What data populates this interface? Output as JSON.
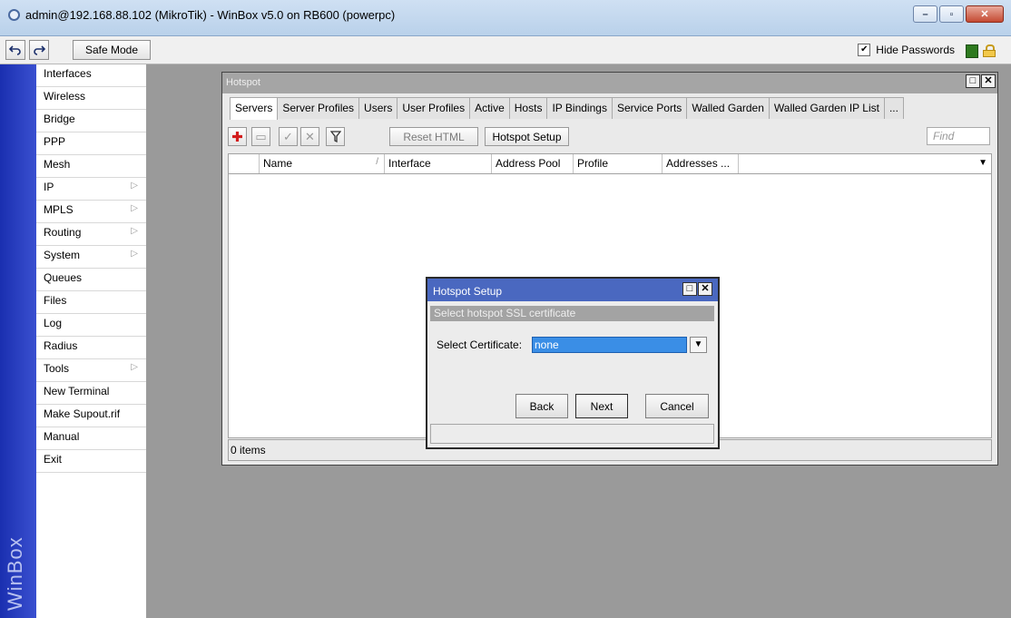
{
  "window": {
    "title": "admin@192.168.88.102 (MikroTik) - WinBox v5.0 on RB600 (powerpc)",
    "buttons": [
      "–",
      "▫",
      "✕"
    ]
  },
  "toolbar": {
    "undo_icon": "undo-icon",
    "redo_icon": "redo-icon",
    "safe_mode": "Safe Mode",
    "hide_passwords": "Hide Passwords",
    "hide_passwords_checked": true
  },
  "sidebar": {
    "brand": "WinBox",
    "items": [
      {
        "label": "Interfaces",
        "submenu": false
      },
      {
        "label": "Wireless",
        "submenu": false
      },
      {
        "label": "Bridge",
        "submenu": false
      },
      {
        "label": "PPP",
        "submenu": false
      },
      {
        "label": "Mesh",
        "submenu": false
      },
      {
        "label": "IP",
        "submenu": true
      },
      {
        "label": "MPLS",
        "submenu": true
      },
      {
        "label": "Routing",
        "submenu": true
      },
      {
        "label": "System",
        "submenu": true
      },
      {
        "label": "Queues",
        "submenu": false
      },
      {
        "label": "Files",
        "submenu": false
      },
      {
        "label": "Log",
        "submenu": false
      },
      {
        "label": "Radius",
        "submenu": false
      },
      {
        "label": "Tools",
        "submenu": true
      },
      {
        "label": "New Terminal",
        "submenu": false
      },
      {
        "label": "Make Supout.rif",
        "submenu": false
      },
      {
        "label": "Manual",
        "submenu": false
      },
      {
        "label": "Exit",
        "submenu": false
      }
    ]
  },
  "hotspot": {
    "title": "Hotspot",
    "tabs": [
      "Servers",
      "Server Profiles",
      "Users",
      "User Profiles",
      "Active",
      "Hosts",
      "IP Bindings",
      "Service Ports",
      "Walled Garden",
      "Walled Garden IP List",
      "..."
    ],
    "active_tab": "Servers",
    "reset_html": "Reset HTML",
    "hotspot_setup": "Hotspot Setup",
    "find_placeholder": "Find",
    "columns": [
      "Name",
      "Interface",
      "Address Pool",
      "Profile",
      "Addresses ..."
    ],
    "sort_marker": "/",
    "status": "0 items"
  },
  "setup_dialog": {
    "title": "Hotspot Setup",
    "subtitle": "Select hotspot SSL certificate",
    "label": "Select Certificate:",
    "value": "none",
    "back": "Back",
    "next": "Next",
    "cancel": "Cancel"
  },
  "colors": {
    "sidebar_strip": "#1a2fb0",
    "dialog_title": "#4a68c0",
    "selected_value": "#3a8ee6"
  }
}
